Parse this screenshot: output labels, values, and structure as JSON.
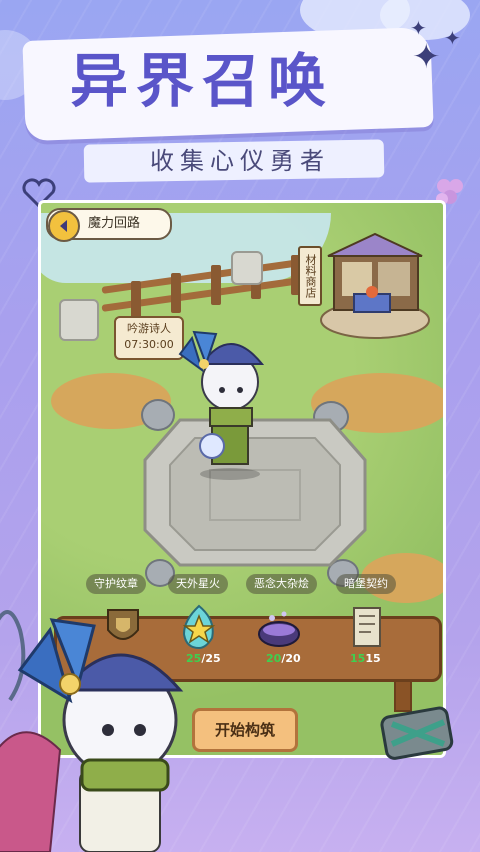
{
  "header": {
    "title": "异界召唤",
    "subtitle": "收集心仪勇者"
  },
  "hud": {
    "back_label": "魔力回路"
  },
  "scene": {
    "shop_sign": "材料商店",
    "npc_sign_name": "吟游诗人",
    "npc_sign_time": "07:30:00"
  },
  "tabs": [
    {
      "label": "守护纹章"
    },
    {
      "label": "天外星火"
    },
    {
      "label": "恶念大杂烩"
    },
    {
      "label": "暗堡契约"
    }
  ],
  "items": [
    {
      "icon": "emblem-icon",
      "have": "",
      "total": ""
    },
    {
      "icon": "star-fire-icon",
      "have": "25",
      "total": "/25"
    },
    {
      "icon": "cauldron-icon",
      "have": "20",
      "total": "/20"
    },
    {
      "icon": "scroll-contract-icon",
      "have": "15",
      "total": "15"
    }
  ],
  "actions": {
    "start_label": "开始构筑"
  },
  "colors": {
    "title": "#5a55c9",
    "have_count": "#3ed050",
    "background": "#a9a0ee"
  }
}
